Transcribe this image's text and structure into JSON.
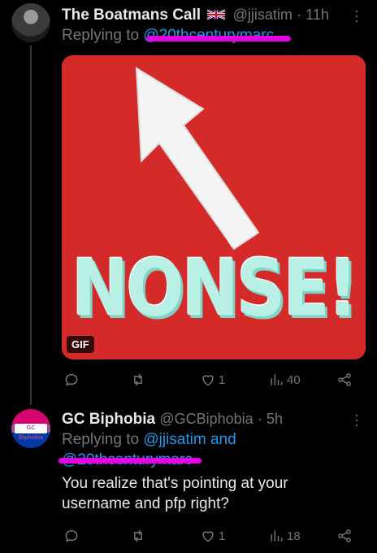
{
  "tweets": [
    {
      "display_name": "The Boatmans Call",
      "handle": "@jjisatim",
      "time": "· 11h",
      "reply_prefix": "Replying to",
      "reply_to_redacted": "@20thcenturymarc",
      "media_text": "NONSE!",
      "media_badge": "GIF",
      "stats": {
        "reply": "",
        "retweet": "",
        "like": "1",
        "views": "40"
      }
    },
    {
      "display_name": "GC Biphobia",
      "handle": "@GCBiphobia",
      "time": "· 5h",
      "avatar_text": "GC Biphobia",
      "reply_prefix": "Replying to",
      "reply_to": "@jjisatim",
      "reply_and": "and",
      "reply_to_redacted": "@20thcenturymarc",
      "text": "You realize that's pointing at your username and pfp right?",
      "stats": {
        "reply": "",
        "retweet": "",
        "like": "1",
        "views": "18"
      }
    }
  ],
  "colors": {
    "accent": "#1d9bf0",
    "muted": "#71767b",
    "redaction": "#e500e5",
    "media_bg": "#d42a2a",
    "media_text": "#b8f0e6"
  }
}
